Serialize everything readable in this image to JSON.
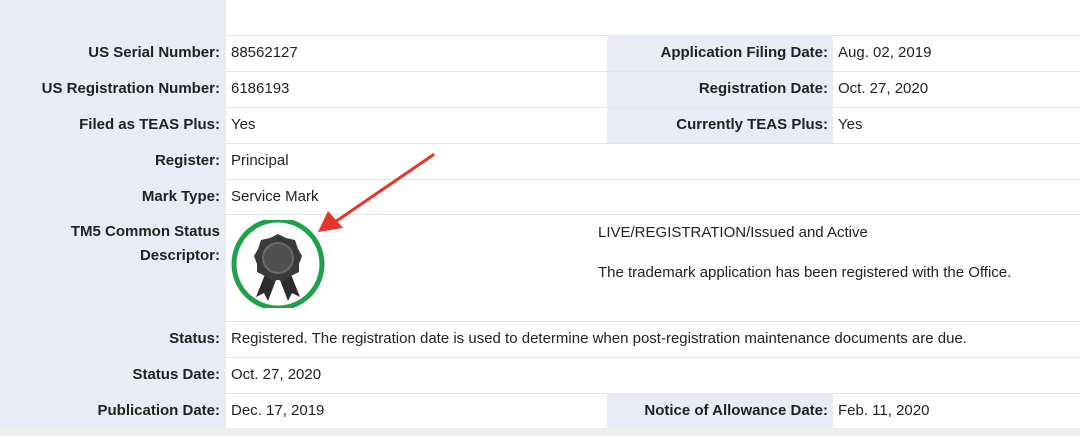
{
  "rows": {
    "serial": {
      "label": "US Serial Number:",
      "value": "88562127"
    },
    "filing_date": {
      "label": "Application Filing Date:",
      "value": "Aug. 02, 2019"
    },
    "reg_number": {
      "label": "US Registration Number:",
      "value": "6186193"
    },
    "reg_date": {
      "label": "Registration Date:",
      "value": "Oct. 27, 2020"
    },
    "teas_filed": {
      "label": "Filed as TEAS Plus:",
      "value": "Yes"
    },
    "teas_current": {
      "label": "Currently TEAS Plus:",
      "value": "Yes"
    },
    "register": {
      "label": "Register:",
      "value": "Principal"
    },
    "mark_type": {
      "label": "Mark Type:",
      "value": "Service Mark"
    },
    "tm5": {
      "label_line1": "TM5 Common Status",
      "label_line2": "Descriptor:",
      "status_title": "LIVE/REGISTRATION/Issued and Active",
      "status_text": "The trademark application has been registered with the Office.",
      "icon": "registered-ribbon-badge-icon",
      "badge_color": "#1fa04a"
    },
    "status": {
      "label": "Status:",
      "value": "Registered. The registration date is used to determine when post-registration maintenance documents are due."
    },
    "status_date": {
      "label": "Status Date:",
      "value": "Oct. 27, 2020"
    },
    "pub_date": {
      "label": "Publication Date:",
      "value": "Dec. 17, 2019"
    },
    "allowance_date": {
      "label": "Notice of Allowance Date:",
      "value": "Feb. 11, 2020"
    }
  },
  "annotation": {
    "icon": "red-arrow-icon",
    "color": "#e8352a"
  }
}
